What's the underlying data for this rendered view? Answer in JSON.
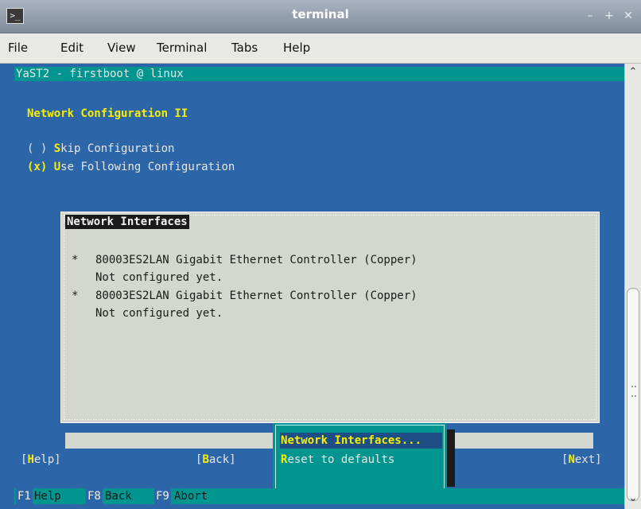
{
  "window": {
    "title": "terminal",
    "minimize": "–",
    "maximize": "+",
    "close": "✕",
    "app_icon": ">_"
  },
  "menu": [
    "File",
    "Edit",
    "View",
    "Terminal",
    "Tabs",
    "Help"
  ],
  "yast": {
    "header": "YaST2 - firstboot @ linux",
    "dialog_title": "Network Configuration II",
    "radio_skip": {
      "mark": "( )",
      "hotkey": "S",
      "rest": "kip Configuration",
      "selected": false
    },
    "radio_use": {
      "mark": "(x)",
      "hotkey": "U",
      "rest": "se Following Configuration",
      "selected": true
    },
    "interfaces_title": "Network Interfaces",
    "interfaces": [
      {
        "bullet": "*",
        "name": "80003ES2LAN Gigabit Ethernet Controller (Copper)",
        "status": "Not configured yet."
      },
      {
        "bullet": "*",
        "name": "80003ES2LAN Gigabit Ethernet Controller (Copper)",
        "status": "Not configured yet."
      }
    ],
    "popup_items": [
      {
        "hotkey": "N",
        "rest": "etwork Interfaces...",
        "selected": true
      },
      {
        "hotkey": "R",
        "rest": "eset to defaults",
        "selected": false
      }
    ],
    "buttons": {
      "help": {
        "open": "[",
        "hotkey": "H",
        "rest": "elp",
        "close": "]"
      },
      "back": {
        "open": "[",
        "hotkey": "B",
        "rest": "ack",
        "close": "]"
      },
      "next": {
        "open": "[",
        "hotkey": "N",
        "rest": "ext",
        "close": "]"
      }
    },
    "fkeys": [
      {
        "key": "F1",
        "label": "Help"
      },
      {
        "key": "F8",
        "label": "Back"
      },
      {
        "key": "F9",
        "label": "Abort"
      }
    ]
  },
  "scrollbar": {
    "up": "⌃",
    "down": "⌄"
  },
  "colors": {
    "terminal_bg": "#2d66a8",
    "accent_teal": "#00968f",
    "hotkey_yellow": "#f6f000",
    "panel_bg": "#d2d8cf"
  }
}
